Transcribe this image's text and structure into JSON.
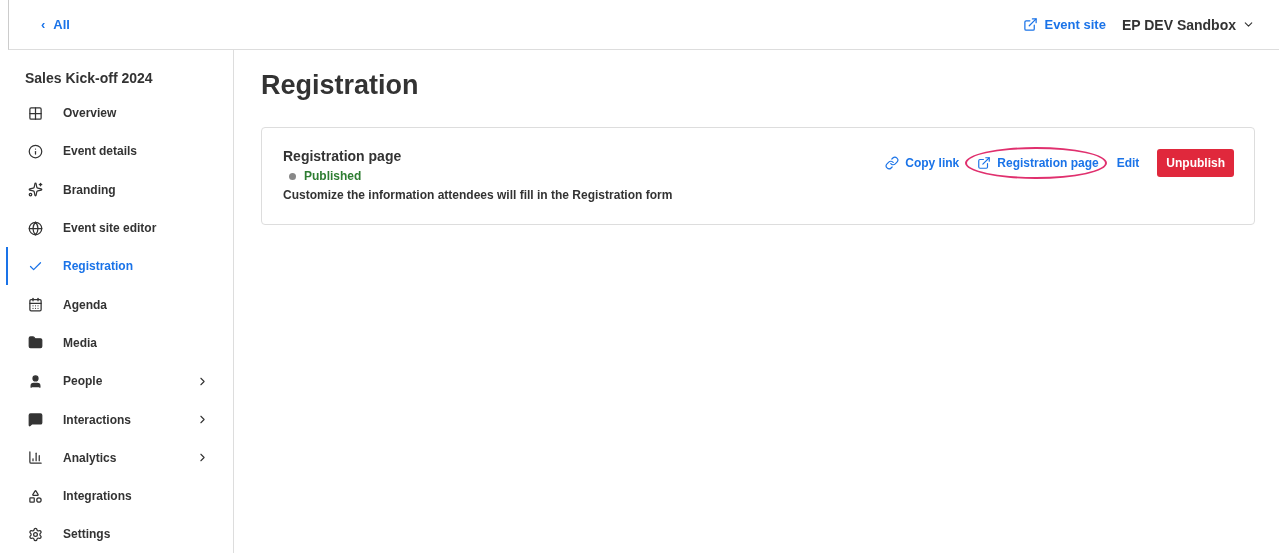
{
  "topbar": {
    "back": {
      "icon": "‹",
      "label": "All"
    },
    "event_site": "Event site",
    "account": "EP DEV Sandbox"
  },
  "sidebar": {
    "title": "Sales Kick-off 2024",
    "items": [
      {
        "label": "Overview",
        "selected": false,
        "expandable": false
      },
      {
        "label": "Event details",
        "selected": false,
        "expandable": false
      },
      {
        "label": "Branding",
        "selected": false,
        "expandable": false
      },
      {
        "label": "Event site editor",
        "selected": false,
        "expandable": false
      },
      {
        "label": "Registration",
        "selected": true,
        "expandable": false
      },
      {
        "label": "Agenda",
        "selected": false,
        "expandable": false
      },
      {
        "label": "Media",
        "selected": false,
        "expandable": false
      },
      {
        "label": "People",
        "selected": false,
        "expandable": true
      },
      {
        "label": "Interactions",
        "selected": false,
        "expandable": true
      },
      {
        "label": "Analytics",
        "selected": false,
        "expandable": true
      },
      {
        "label": "Integrations",
        "selected": false,
        "expandable": false
      },
      {
        "label": "Settings",
        "selected": false,
        "expandable": false
      }
    ]
  },
  "page": {
    "title": "Registration",
    "card": {
      "title": "Registration page",
      "status": "Published",
      "description": "Customize the information attendees will fill in the Registration form",
      "actions": [
        {
          "kind": "link",
          "label": "Copy link",
          "highlighted": false
        },
        {
          "kind": "external",
          "label": "Registration page",
          "highlighted": true
        },
        {
          "kind": "plain",
          "label": "Edit",
          "highlighted": false
        },
        {
          "kind": "danger",
          "label": "Unpublish",
          "highlighted": false
        }
      ]
    }
  }
}
